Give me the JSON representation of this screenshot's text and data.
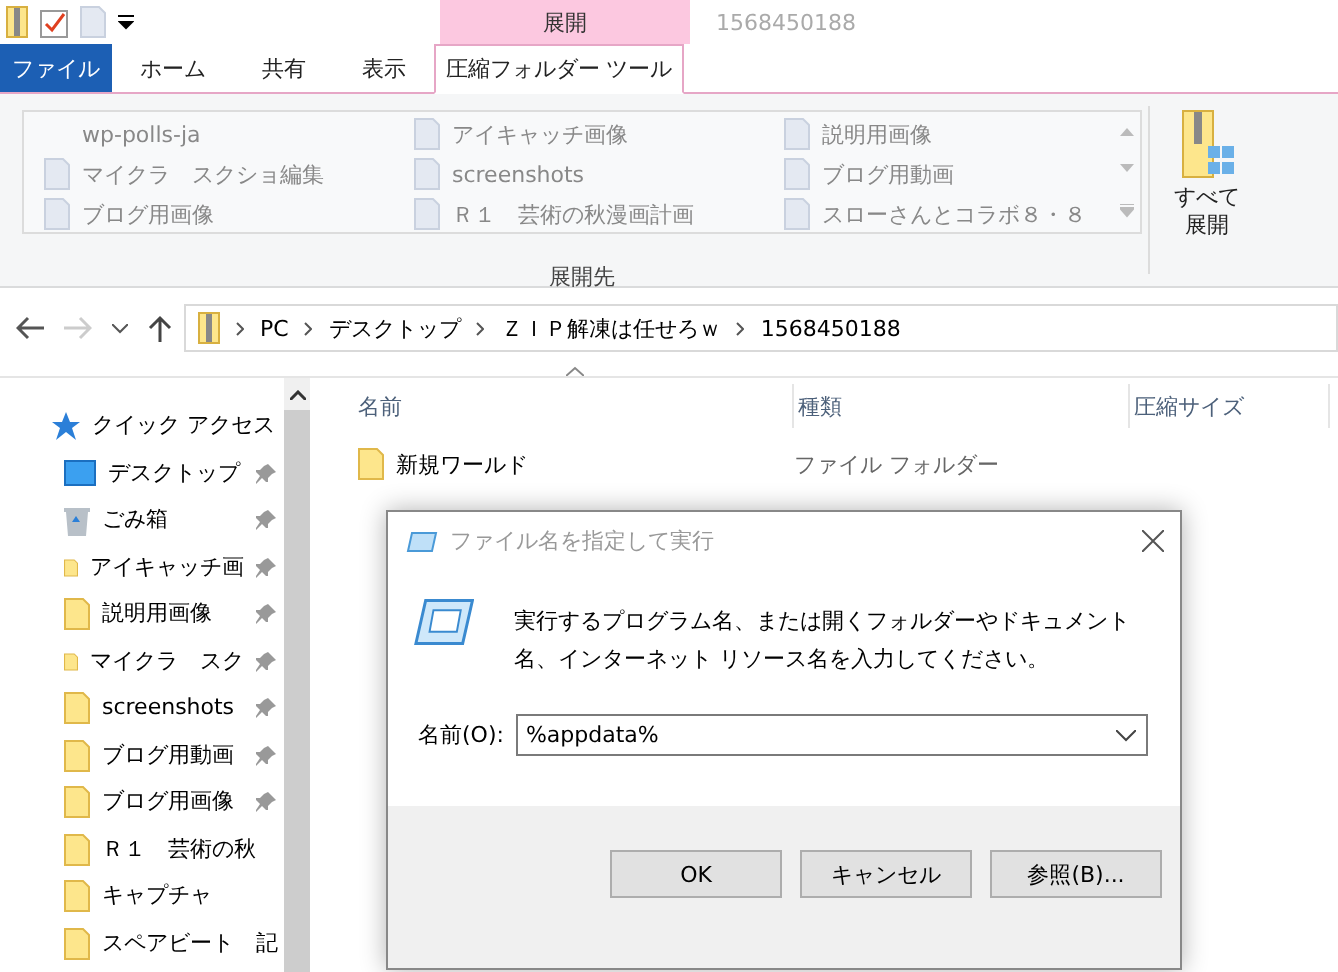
{
  "window": {
    "title": "1568450188",
    "context_tab_group": "展開"
  },
  "ribbon": {
    "tabs": [
      {
        "label": "ファイル",
        "kind": "file",
        "selected": false
      },
      {
        "label": "ホーム",
        "kind": "normal",
        "selected": false
      },
      {
        "label": "共有",
        "kind": "normal",
        "selected": false
      },
      {
        "label": "表示",
        "kind": "normal",
        "selected": false
      },
      {
        "label": "圧縮フォルダー ツール",
        "kind": "context",
        "selected": true
      }
    ],
    "gallery": [
      {
        "label": "wp-polls-ja",
        "kind": "plain"
      },
      {
        "label": "アイキャッチ画像",
        "kind": "folder"
      },
      {
        "label": "説明用画像",
        "kind": "folder"
      },
      {
        "label": "マイクラ　スクショ編集",
        "kind": "folder"
      },
      {
        "label": "screenshots",
        "kind": "folder"
      },
      {
        "label": "ブログ用動画",
        "kind": "folder"
      },
      {
        "label": "ブログ用画像",
        "kind": "folder"
      },
      {
        "label": "Ｒ１　芸術の秋漫画計画",
        "kind": "folder"
      },
      {
        "label": "スローさんとコラボ８・８",
        "kind": "folder"
      }
    ],
    "group_label": "展開先",
    "extract_all": [
      "すべて",
      "展開"
    ]
  },
  "address": {
    "segments": [
      "PC",
      "デスクトップ",
      "ＺＩＰ解凍は任せろｗ",
      "1568450188"
    ]
  },
  "sidebar": {
    "items": [
      {
        "label": "クイック アクセス",
        "kind": "quick"
      },
      {
        "label": "デスクトップ",
        "kind": "desktop",
        "pinned": true
      },
      {
        "label": "ごみ箱",
        "kind": "recycle",
        "pinned": true
      },
      {
        "label": "アイキャッチ画",
        "kind": "folder",
        "pinned": true
      },
      {
        "label": "説明用画像",
        "kind": "folder",
        "pinned": true
      },
      {
        "label": "マイクラ　スク",
        "kind": "folder",
        "pinned": true
      },
      {
        "label": "screenshots",
        "kind": "folder",
        "pinned": true
      },
      {
        "label": "ブログ用動画",
        "kind": "folder",
        "pinned": true
      },
      {
        "label": "ブログ用画像",
        "kind": "folder",
        "pinned": true
      },
      {
        "label": "Ｒ１　芸術の秋",
        "kind": "folder",
        "pinned": false
      },
      {
        "label": "キャプチャ",
        "kind": "folder",
        "pinned": false
      },
      {
        "label": "スペアビート　記",
        "kind": "folder",
        "pinned": false
      }
    ]
  },
  "table": {
    "columns": [
      "名前",
      "種類",
      "圧縮サイズ"
    ],
    "rows": [
      {
        "name": "新規ワールド",
        "type": "ファイル フォルダー"
      }
    ]
  },
  "dialog": {
    "title": "ファイル名を指定して実行",
    "message": "実行するプログラム名、または開くフォルダーやドキュメント名、インターネット リソース名を入力してください。",
    "field_label": "名前(O):",
    "value": "%appdata%",
    "buttons": [
      "OK",
      "キャンセル",
      "参照(B)..."
    ]
  }
}
